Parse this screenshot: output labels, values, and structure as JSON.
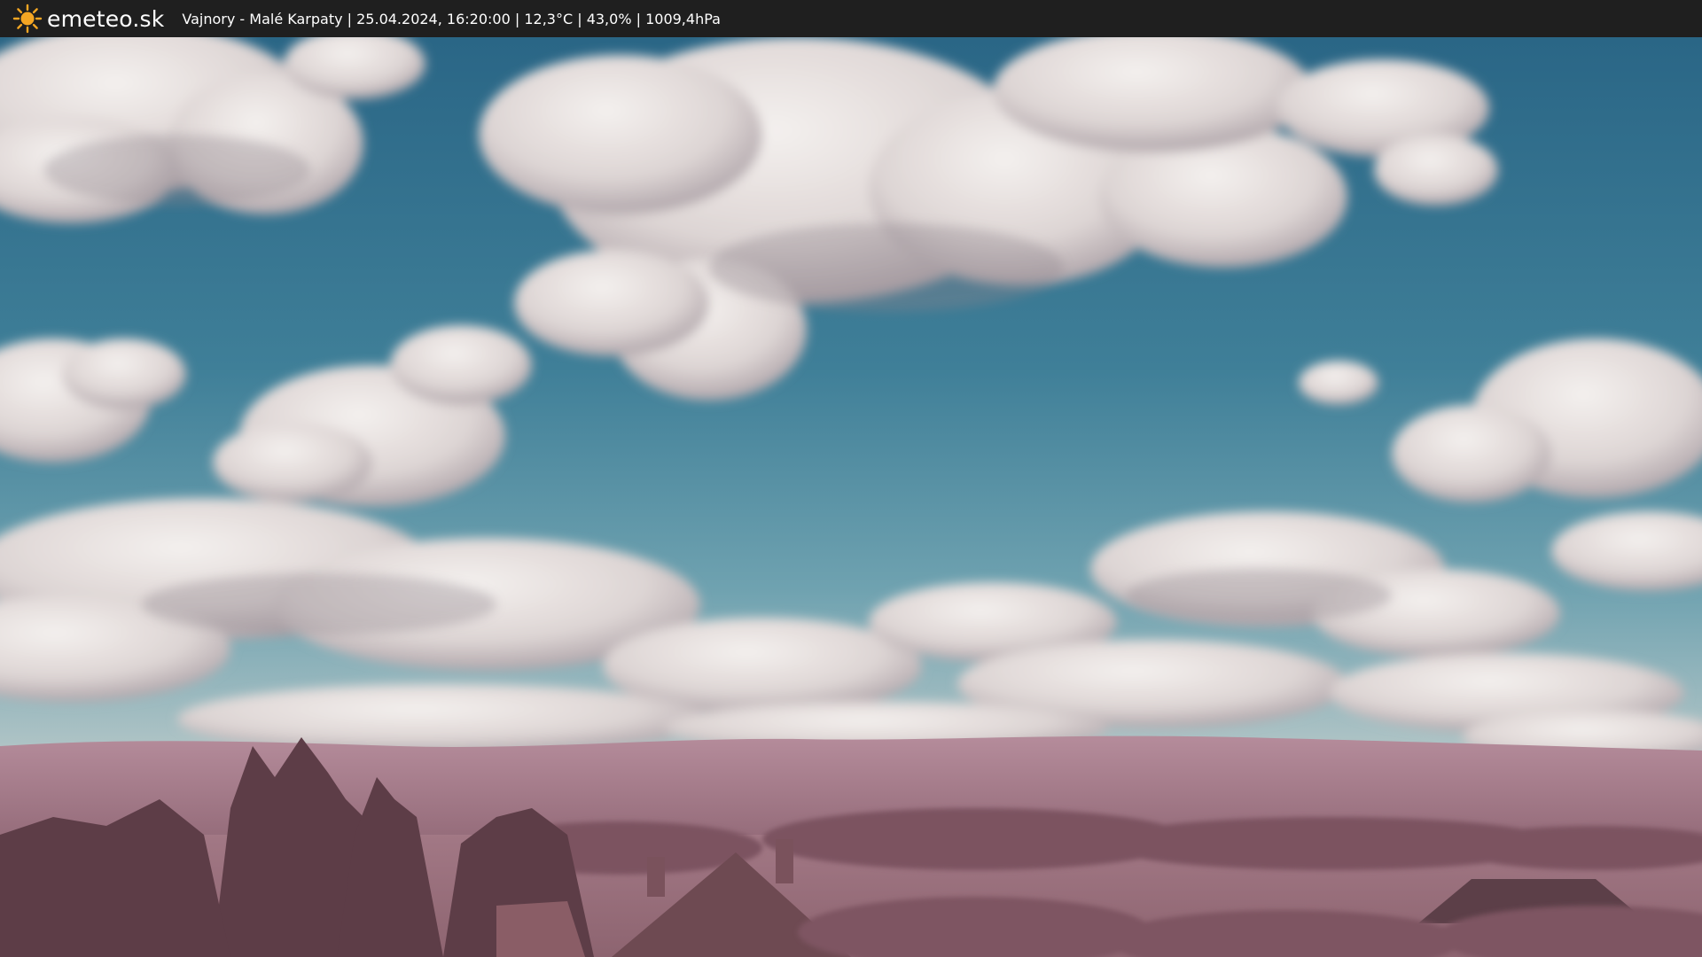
{
  "header": {
    "brand": "emeteo.sk",
    "brand_icon": "sun-icon",
    "caption": "Vajnory - Malé Karpaty | 25.04.2024, 16:20:00 | 12,3°C | 43,0% | 1009,4hPa"
  },
  "colors": {
    "bar": "#1f1f1f",
    "sun": "#f5a623",
    "sky_top": "#2f6f8f",
    "sky_bottom": "#7aa9b5",
    "cloud": "#e9e4e2",
    "cloud_shadow": "#a99ea4",
    "hills": "#a77d8c",
    "foliage": "#6f4a55"
  }
}
